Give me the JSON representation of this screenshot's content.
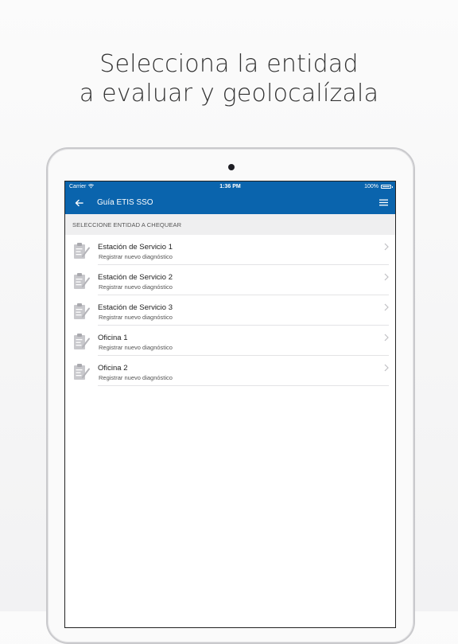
{
  "headline": {
    "line1": "Selecciona la entidad",
    "line2": "a evaluar y geolocalízala"
  },
  "status_bar": {
    "carrier": "Carrier",
    "time": "1:36 PM",
    "battery": "100%"
  },
  "navbar": {
    "title": "Guía ETIS SSO",
    "back_icon": "arrow-left-icon",
    "menu_icon": "hamburger-menu-icon"
  },
  "section_header": "SELECCIONE ENTIDAD A CHEQUEAR",
  "entities": [
    {
      "title": "Estación de Servicio 1",
      "subtitle": "Registrar nuevo diagnóstico"
    },
    {
      "title": "Estación de Servicio 2",
      "subtitle": "Registrar nuevo diagnóstico"
    },
    {
      "title": "Estación de Servicio 3",
      "subtitle": "Registrar nuevo diagnóstico"
    },
    {
      "title": "Oficina 1",
      "subtitle": "Registrar nuevo diagnóstico"
    },
    {
      "title": "Oficina 2",
      "subtitle": "Registrar nuevo diagnóstico"
    }
  ],
  "colors": {
    "brand_blue": "#0a64ad",
    "section_bg": "#efeff0",
    "icon_gray": "#c8c8cc"
  }
}
